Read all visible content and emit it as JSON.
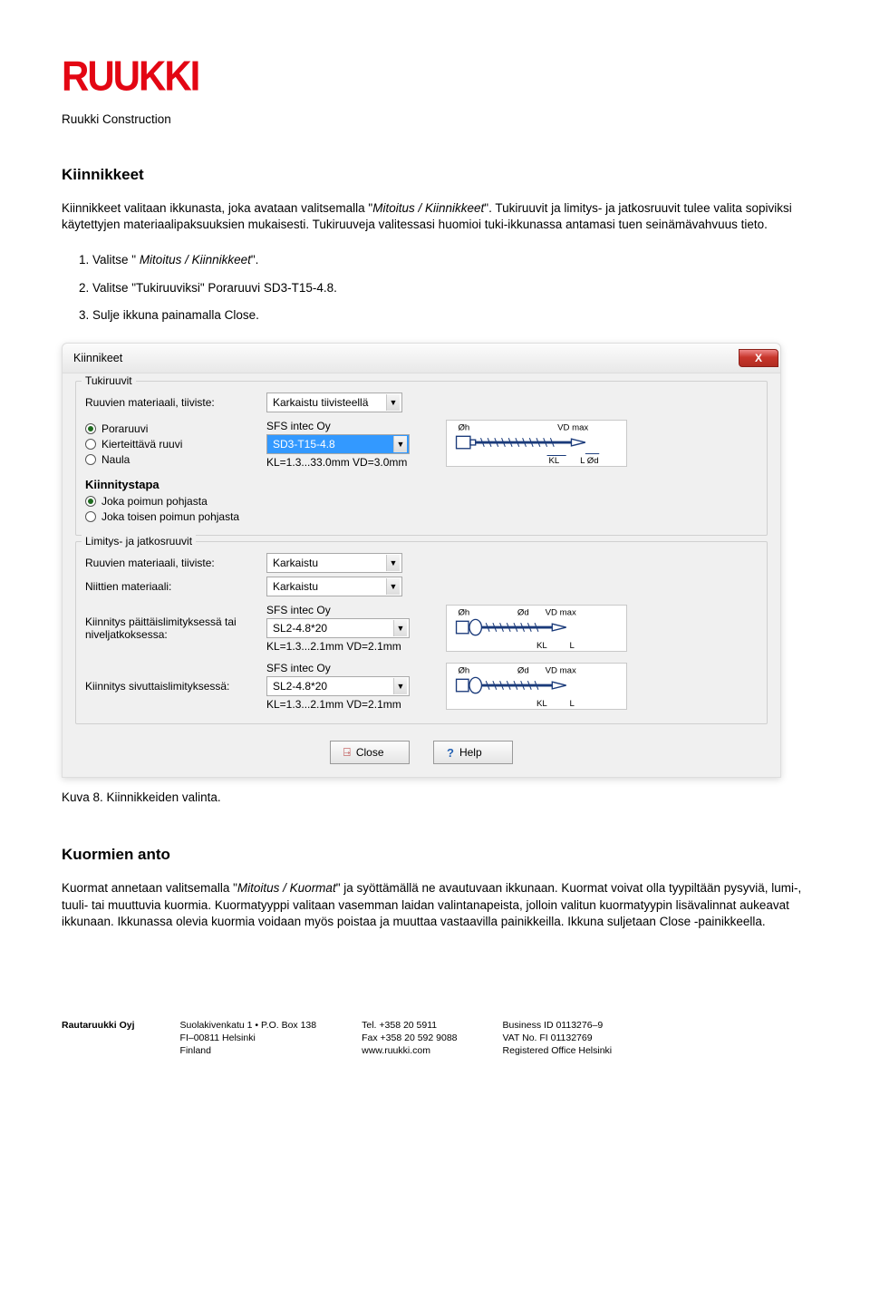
{
  "header": {
    "logo_text": "RUUKKI",
    "sub": "Ruukki Construction"
  },
  "section1": {
    "title": "Kiinnikkeet",
    "intro_pre": "Kiinnikkeet valitaan ikkunasta, joka avataan valitsemalla \"",
    "intro_italic": "Mitoitus / Kiinnikkeet",
    "intro_post": "\". Tukiruuvit ja limitys- ja jatkosruuvit tulee valita sopiviksi käytettyjen materiaalipaksuuksien mukaisesti. Tukiruuveja valitessasi huomioi tuki-ikkunassa antamasi tuen seinämävahvuus tieto.",
    "steps": [
      {
        "pre": "Valitse \" ",
        "italic": "Mitoitus / Kiinnikkeet",
        "post": "\"."
      },
      {
        "pre": "Valitse \"Tukiruuviksi\" Poraruuvi SD3-T15-4.8.",
        "italic": "",
        "post": ""
      },
      {
        "pre": "Sulje ikkuna painamalla Close.",
        "italic": "",
        "post": ""
      }
    ]
  },
  "dialog": {
    "title": "Kiinnikeet",
    "close_x": "X",
    "grp1_label": "Tukiruuvit",
    "mat_label1": "Ruuvien materiaali, tiiviste:",
    "mat_combo1": "Karkaistu tiivisteellä",
    "radio_poraruuvi": "Poraruuvi",
    "radio_kierte": "Kierteittävä ruuvi",
    "radio_naula": "Naula",
    "spec_maker1": "SFS intec Oy",
    "spec_combo1": "SD3-T15-4.8",
    "spec_dim1": "KL=1.3...33.0mm  VD=3.0mm",
    "subheading_kt": "Kiinnitystapa",
    "radio_k1": "Joka poimun pohjasta",
    "radio_k2": "Joka toisen poimun pohjasta",
    "grp2_label": "Limitys- ja jatkosruuvit",
    "mat_label2": "Ruuvien materiaali, tiiviste:",
    "mat_combo2": "Karkaistu",
    "niit_label": "Niittien materiaali:",
    "niit_combo": "Karkaistu",
    "row3_lbl": "Kiinnitys päittäislimityksessä tai niveljatkoksessa:",
    "spec_maker2": "SFS intec Oy",
    "spec_combo2": "SL2-4.8*20",
    "spec_dim2": "KL=1.3...2.1mm  VD=2.1mm",
    "row4_lbl": "Kiinnitys sivuttaislimityksessä:",
    "spec_maker3": "SFS intec Oy",
    "spec_combo3": "SL2-4.8*20",
    "spec_dim3": "KL=1.3...2.1mm  VD=2.1mm",
    "btn_close": "Close",
    "btn_help": "Help",
    "diag_labels": {
      "oh": "Øh",
      "vdmax": "VD max",
      "kl": "KL",
      "l": "L",
      "od": "Ød"
    }
  },
  "caption": "Kuva 8. Kiinnikkeiden valinta.",
  "section2": {
    "title": "Kuormien anto",
    "body_pre": "Kuormat annetaan valitsemalla \"",
    "body_italic": "Mitoitus / Kuormat",
    "body_post": "\" ja syöttämällä ne avautuvaan ikkunaan. Kuormat voivat olla tyypiltään pysyviä, lumi-, tuuli- tai muuttuvia kuormia. Kuormatyyppi valitaan vasemman laidan valintanapeista, jolloin valitun kuormatyypin lisävalinnat aukeavat ikkunaan. Ikkunassa olevia kuormia voidaan myös poistaa ja muuttaa vastaavilla painikkeilla. Ikkuna suljetaan Close -painikkeella."
  },
  "footer": {
    "c1a": "Rautaruukki Oyj",
    "c2a": "Suolakivenkatu 1 • P.O. Box 138",
    "c2b": "FI–00811 Helsinki",
    "c2c": "Finland",
    "c3a": "Tel. +358 20 5911",
    "c3b": "Fax +358 20 592 9088",
    "c3c": "www.ruukki.com",
    "c4a": "Business ID 0113276–9",
    "c4b": "VAT No. FI 01132769",
    "c4c": "Registered Office Helsinki"
  }
}
